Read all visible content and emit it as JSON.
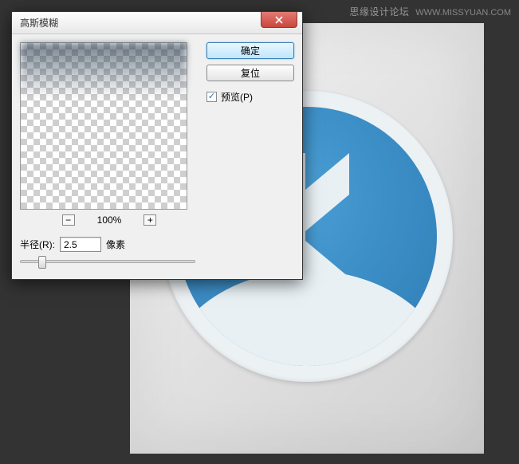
{
  "watermark": {
    "text": "思缘设计论坛",
    "site": "WWW.MISSYUAN.COM"
  },
  "dialog": {
    "title": "高斯模糊",
    "close_icon": "close",
    "zoom": {
      "minus": "⊟",
      "plus": "⊞",
      "level": "100%"
    },
    "radius": {
      "label": "半径(R):",
      "value": "2.5",
      "unit": "像素"
    },
    "buttons": {
      "ok": "确定",
      "cancel": "复位"
    },
    "preview_checkbox": {
      "checked": true,
      "label": "预览(P)"
    }
  }
}
